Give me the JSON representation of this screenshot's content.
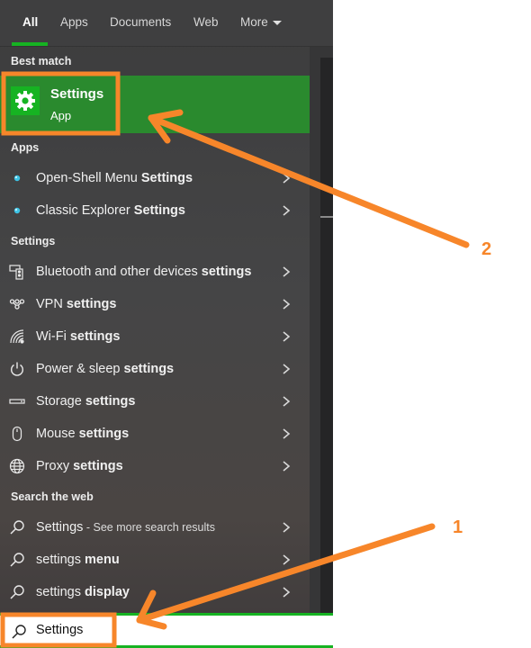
{
  "tabs": [
    {
      "label": "All",
      "active": true
    },
    {
      "label": "Apps",
      "active": false
    },
    {
      "label": "Documents",
      "active": false
    },
    {
      "label": "Web",
      "active": false
    },
    {
      "label": "More",
      "active": false
    }
  ],
  "sections": {
    "best_match": "Best match",
    "apps": "Apps",
    "settings": "Settings",
    "search_web": "Search the web"
  },
  "best_match": {
    "title": "Settings",
    "subtitle": "App",
    "icon": "gear-icon"
  },
  "apps": [
    {
      "prefix": "Open-Shell Menu ",
      "bold": "Settings",
      "icon": "open-shell-icon"
    },
    {
      "prefix": "Classic Explorer ",
      "bold": "Settings",
      "icon": "open-shell-icon"
    }
  ],
  "settings": [
    {
      "prefix": "Bluetooth and other devices ",
      "bold": "settings",
      "icon": "bluetooth-devices-icon"
    },
    {
      "prefix": "VPN ",
      "bold": "settings",
      "icon": "vpn-icon"
    },
    {
      "prefix": "Wi-Fi ",
      "bold": "settings",
      "icon": "wifi-icon"
    },
    {
      "prefix": "Power & sleep ",
      "bold": "settings",
      "icon": "power-icon"
    },
    {
      "prefix": "Storage ",
      "bold": "settings",
      "icon": "storage-icon"
    },
    {
      "prefix": "Mouse ",
      "bold": "settings",
      "icon": "mouse-icon"
    },
    {
      "prefix": "Proxy ",
      "bold": "settings",
      "icon": "globe-icon"
    }
  ],
  "web": [
    {
      "prefix": "Settings",
      "bold": "",
      "suffix": " - See more search results",
      "icon": "search-icon"
    },
    {
      "prefix": "settings ",
      "bold": "menu",
      "suffix": "",
      "icon": "search-icon"
    },
    {
      "prefix": "settings ",
      "bold": "display",
      "suffix": "",
      "icon": "search-icon"
    }
  ],
  "search": {
    "value": "Settings"
  },
  "annotations": {
    "one": "1",
    "two": "2",
    "color": "#f7862a"
  },
  "colors": {
    "accent_green": "#16b322",
    "best_match_bg": "#2a8a2e",
    "annotation_orange": "#f7862a"
  }
}
